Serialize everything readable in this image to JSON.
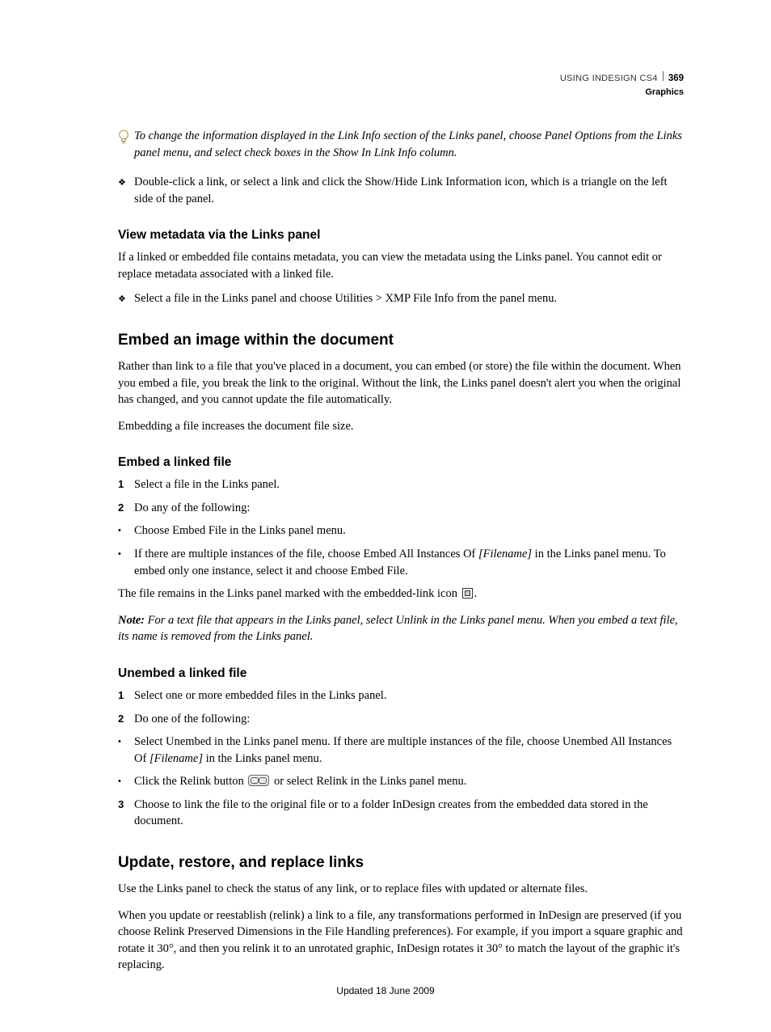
{
  "header": {
    "product": "USING INDESIGN CS4",
    "page_number": "369",
    "section": "Graphics"
  },
  "tip": "To change the information displayed in the Link Info section of the Links panel, choose Panel Options from the Links panel menu, and select check boxes in the Show In Link Info column.",
  "diamond_item_1": "Double-click a link, or select a link and click the Show/Hide Link Information icon, which is a triangle on the left side of the panel.",
  "view_metadata": {
    "heading": "View metadata via the Links panel",
    "para": "If a linked or embedded file contains metadata, you can view the metadata using the Links panel. You cannot edit or replace metadata associated with a linked file.",
    "item": "Select a file in the Links panel and choose Utilities > XMP File Info from the panel menu."
  },
  "embed_section": {
    "heading": "Embed an image within the document",
    "p1": "Rather than link to a file that you've placed in a document, you can embed (or store) the file within the document. When you embed a file, you break the link to the original. Without the link, the Links panel doesn't alert you when the original has changed, and you cannot update the file automatically.",
    "p2": "Embedding a file increases the document file size."
  },
  "embed_linked": {
    "heading": "Embed a linked file",
    "s1": "Select a file in the Links panel.",
    "s2": "Do any of the following:",
    "b1": "Choose Embed File in the Links panel menu.",
    "b2a": "If there are multiple instances of the file, choose Embed All Instances Of ",
    "b2_fn": "[Filename]",
    "b2b": " in the Links panel menu. To embed only one instance, select it and choose Embed File.",
    "after1": "The file remains in the Links panel marked with the embedded-link icon ",
    "after1_tail": ".",
    "note_label": "Note:",
    "note_body": " For a text file that appears in the Links panel, select Unlink in the Links panel menu. When you embed a text file, its name is removed from the Links panel."
  },
  "unembed": {
    "heading": "Unembed a linked file",
    "s1": "Select one or more embedded files in the Links panel.",
    "s2": "Do one of the following:",
    "b1a": "Select Unembed in the Links panel menu. If there are multiple instances of the file, choose Unembed All Instances Of ",
    "b1_fn": "[Filename]",
    "b1b": " in the Links panel menu.",
    "b2a": "Click the Relink button ",
    "b2b": " or select Relink in the Links panel menu.",
    "s3": "Choose to link the file to the original file or to a folder InDesign creates from the embedded data stored in the document."
  },
  "update_section": {
    "heading": "Update, restore, and replace links",
    "p1": "Use the Links panel to check the status of any link, or to replace files with updated or alternate files.",
    "p2": "When you update or reestablish (relink) a link to a file, any transformations performed in InDesign are preserved (if you choose Relink Preserved Dimensions in the File Handling preferences). For example, if you import a square graphic and rotate it 30°, and then you relink it to an unrotated graphic, InDesign rotates it 30° to match the layout of the graphic it's replacing."
  },
  "footer": "Updated 18 June 2009"
}
